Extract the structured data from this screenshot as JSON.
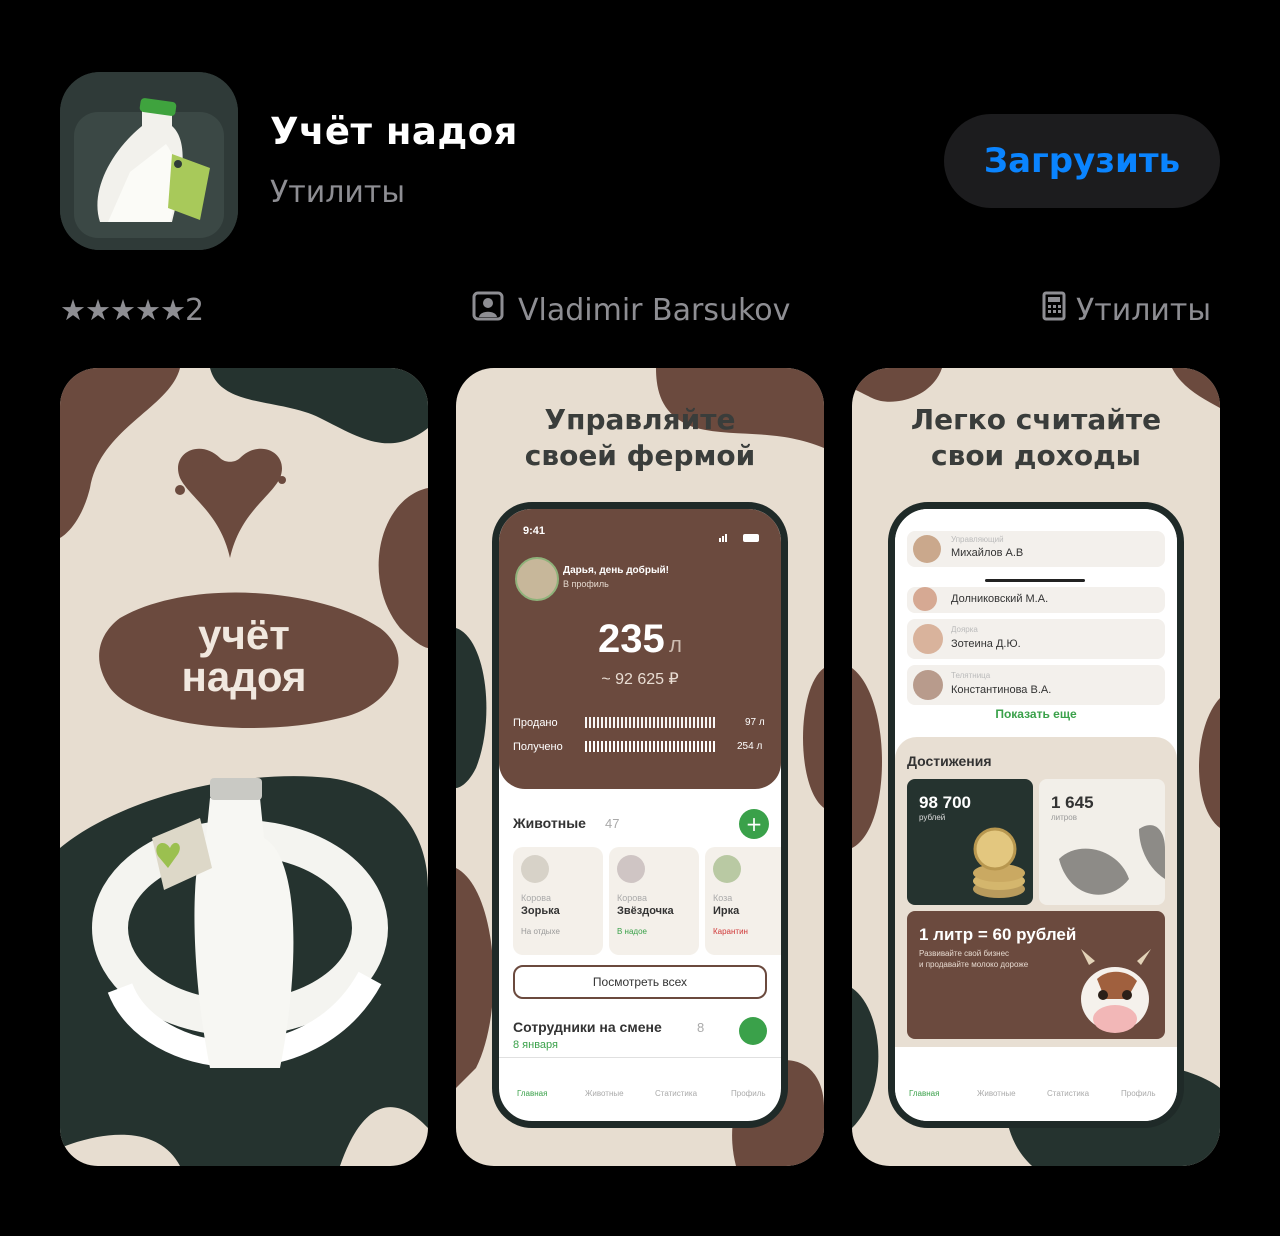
{
  "app": {
    "title": "Учёт надоя",
    "category": "Утилиты",
    "get_label": "Загрузить"
  },
  "info": {
    "stars": "★★★★★",
    "rating_count": "2",
    "developer": "Vladimir Barsukov",
    "category": "Утилиты",
    "developer_icon": "person-icon",
    "category_icon": "calculator-icon"
  },
  "colors": {
    "brown": "#6b4a3e",
    "dark_green": "#25332f",
    "beige": "#e7ddd0",
    "accent_green": "#3aa14a",
    "link_blue": "#0a84ff"
  },
  "screens": {
    "s1": {
      "logo_line1": "учёт",
      "logo_line2": "надоя"
    },
    "s2": {
      "headline1": "Управляйте",
      "headline2": "своей фермой",
      "status_time": "9:41",
      "greeting": "Дарья, день добрый!",
      "profile_link": "В профиль",
      "total_amount": "235",
      "total_unit": "л",
      "total_money": "~ 92 625 ₽",
      "sold_label": "Продано",
      "sold_value": "97 л",
      "received_label": "Получено",
      "received_value": "254 л",
      "animals_title": "Животные",
      "animals_count": "47",
      "animals": [
        {
          "type": "Корова",
          "name": "Зорька",
          "status": "На отдыхе"
        },
        {
          "type": "Корова",
          "name": "Звёздочка",
          "status": "В надое"
        },
        {
          "type": "Коза",
          "name": "Ирка",
          "status": "Карантин"
        }
      ],
      "view_all": "Посмотреть всех",
      "staff_title": "Сотрудники на смене",
      "staff_count": "8",
      "staff_date": "8 января",
      "tabs": [
        "Главная",
        "Животные",
        "Статистика",
        "Профиль"
      ]
    },
    "s3": {
      "headline1": "Легко считайте",
      "headline2": "свои доходы",
      "staff": [
        {
          "role": "Управляющий",
          "name": "Михайлов А.В"
        },
        {
          "role": "",
          "name": "Долниковский М.А."
        },
        {
          "role": "Доярка",
          "name": "Зотеина Д.Ю."
        },
        {
          "role": "Телятница",
          "name": "Константинова В.А."
        }
      ],
      "show_more": "Показать еще",
      "achievements_title": "Достижения",
      "money_value": "98 700",
      "money_unit": "рублей",
      "liters_value": "1 645",
      "liters_unit": "литров",
      "promo_title": "1 литр = 60 рублей",
      "promo_text1": "Развивайте свой бизнес",
      "promo_text2": "и продавайте молоко дороже",
      "tabs": [
        "Главная",
        "Животные",
        "Статистика",
        "Профиль"
      ]
    }
  }
}
